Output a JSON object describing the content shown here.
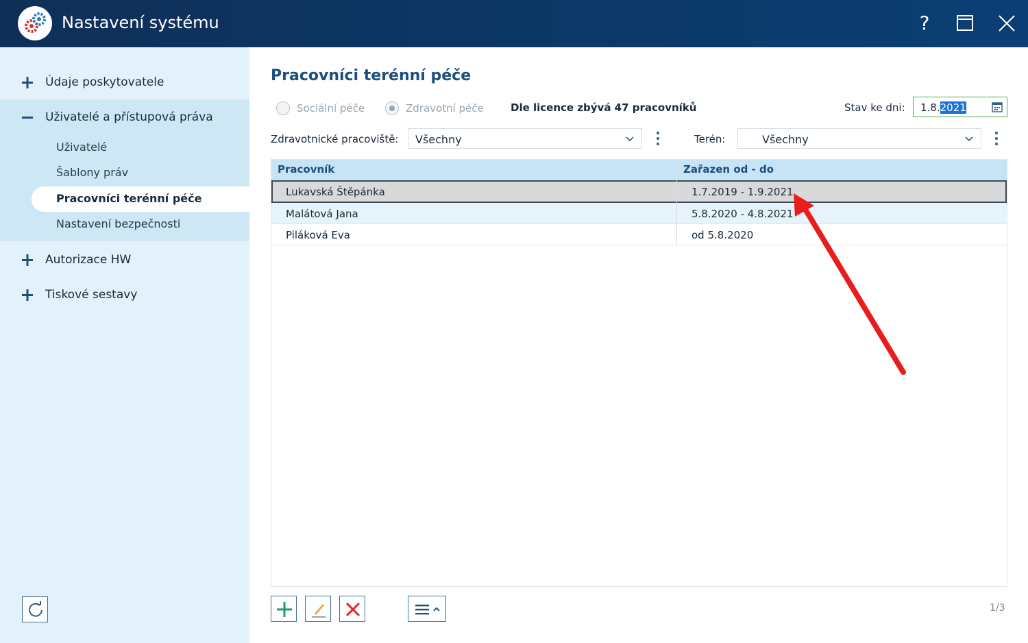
{
  "window": {
    "title": "Nastavení systému",
    "help_glyph": "?"
  },
  "sidebar": {
    "items": [
      {
        "label": "Údaje poskytovatele",
        "sign": "+"
      },
      {
        "label": "Uživatelé a přístupová práva",
        "sign": "−"
      },
      {
        "label": "Autorizace HW",
        "sign": "+"
      },
      {
        "label": "Tiskové sestavy",
        "sign": "+"
      }
    ],
    "subitems": [
      {
        "label": "Uživatelé"
      },
      {
        "label": "Šablony práv"
      },
      {
        "label": "Pracovníci terénní péče",
        "active": true
      },
      {
        "label": "Nastavení bezpečnosti"
      }
    ]
  },
  "main": {
    "title": "Pracovníci terénní péče",
    "radios": [
      {
        "label": "Sociální péče",
        "checked": false
      },
      {
        "label": "Zdravotní péče",
        "checked": true
      }
    ],
    "licence_text": "Dle licence zbývá 47 pracovníků",
    "date_label": "Stav ke dni:",
    "date_value_prefix": "1.8.",
    "date_value_selected": "2021",
    "filters": {
      "workplace_label": "Zdravotnické pracoviště:",
      "workplace_value": "Všechny",
      "terrain_label": "Terén:",
      "terrain_value": "Všechny"
    },
    "table": {
      "columns": [
        "Pracovník",
        "Zařazen od - do"
      ],
      "rows": [
        {
          "worker": "Lukavská Štěpánka",
          "period": "1.7.2019 - 1.9.2021"
        },
        {
          "worker": "Malátová Jana",
          "period": "5.8.2020 - 4.8.2021"
        },
        {
          "worker": "Piláková Eva",
          "period": "od 5.8.2020"
        }
      ]
    },
    "pager": "1/3"
  },
  "colors": {
    "titlebar": "#0b3f74",
    "sidebar": "#e3f2fa",
    "accent": "#1b4f7d",
    "annotation_arrow": "#e81e1e"
  },
  "icons": {
    "logo": "gears-icon",
    "add": "plus-icon",
    "edit": "pencil-icon",
    "delete": "x-icon",
    "menu": "hamburger-menu-icon",
    "refresh": "refresh-icon",
    "calendar": "calendar-icon"
  }
}
